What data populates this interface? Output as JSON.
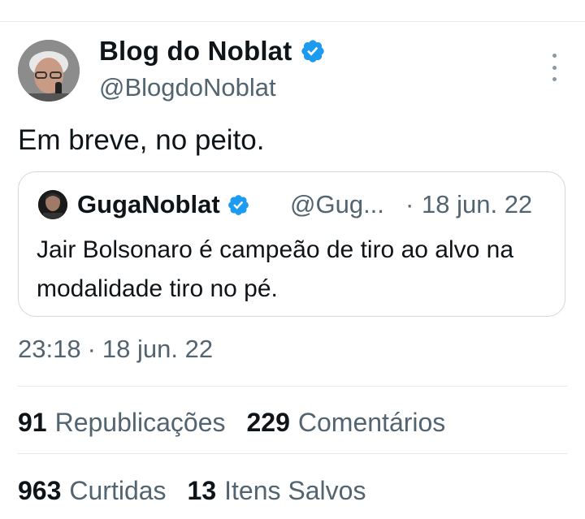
{
  "tweet": {
    "author": {
      "name": "Blog do Noblat",
      "handle": "@BlogdoNoblat",
      "verified": true
    },
    "text": "Em breve, no peito.",
    "quote": {
      "name": "GugaNoblat",
      "handle": "@Gug...",
      "separator": "·",
      "date": "18 jun. 22",
      "text": "Jair Bolsonaro é campeão de tiro ao alvo na modalidade tiro no pé."
    },
    "time": "23:18",
    "time_separator": "·",
    "date": "18 jun. 22",
    "stats": {
      "reposts": {
        "count": "91",
        "label": "Republicações"
      },
      "comments": {
        "count": "229",
        "label": "Comentários"
      },
      "likes": {
        "count": "963",
        "label": "Curtidas"
      },
      "bookmarks": {
        "count": "13",
        "label": "Itens Salvos"
      }
    }
  },
  "colors": {
    "verified": "#1d9bf0",
    "secondary_text": "#536471",
    "border": "#cfd9de"
  }
}
